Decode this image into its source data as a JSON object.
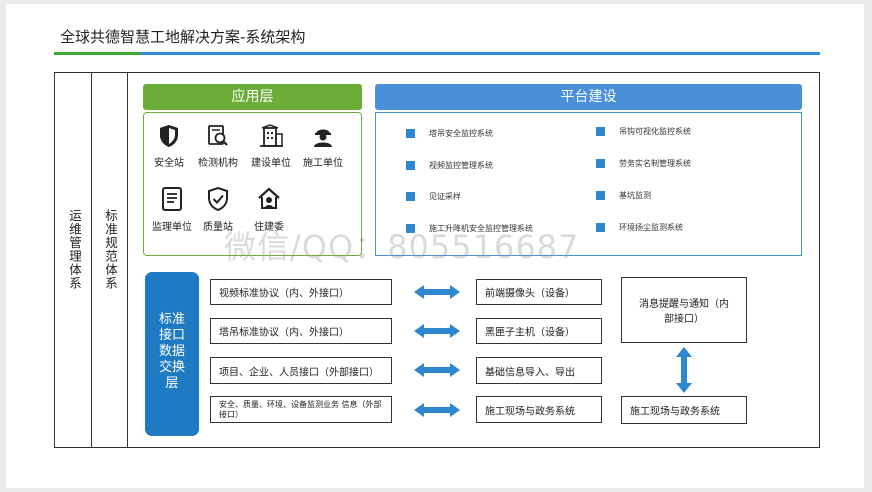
{
  "title": "全球共德智慧工地解决方案-系统架构",
  "left_columns": {
    "ops": "运维管理体系",
    "std": "标准规范体系"
  },
  "app_layer": {
    "header": "应用层",
    "items": [
      {
        "label": "安全站",
        "icon": "shield-icon"
      },
      {
        "label": "检测机构",
        "icon": "inspection-icon"
      },
      {
        "label": "建设单位",
        "icon": "building-icon"
      },
      {
        "label": "施工单位",
        "icon": "worker-icon"
      },
      {
        "label": "监理单位",
        "icon": "document-icon"
      },
      {
        "label": "质量站",
        "icon": "quality-shield-icon"
      },
      {
        "label": "住建委",
        "icon": "house-icon"
      }
    ]
  },
  "platform": {
    "header": "平台建设",
    "items": [
      "塔吊安全监控系统",
      "吊钩可视化监控系统",
      "视频监控管理系统",
      "劳务实名制管理系统",
      "见证采样",
      "基坑监测",
      "施工升降机安全监控管理系统",
      "环境扬尘监测系统"
    ]
  },
  "exchange_layer": {
    "label": "标准接口数据交换层"
  },
  "protocols": [
    "视频标准协议（内、外接口）",
    "塔吊标准协议（内、外接口）",
    "项目、企业、人员接口（外部接口）",
    "安全、质量、环境、设备监测业务 信息（外部接口）"
  ],
  "targets": [
    "前端摄像头（设备）",
    "黑匣子主机（设备）",
    "基础信息导入、导出",
    "施工现场与政务系统"
  ],
  "right_boxes": {
    "notify": "消息提醒与通知（内部接口）",
    "gov": "施工现场与政务系统"
  },
  "watermark": "微信/QQ：805516687",
  "colors": {
    "green": "#6cad37",
    "blue": "#4a90d9",
    "dark_blue": "#1f7ac4",
    "arrow_blue": "#2e87cf"
  }
}
